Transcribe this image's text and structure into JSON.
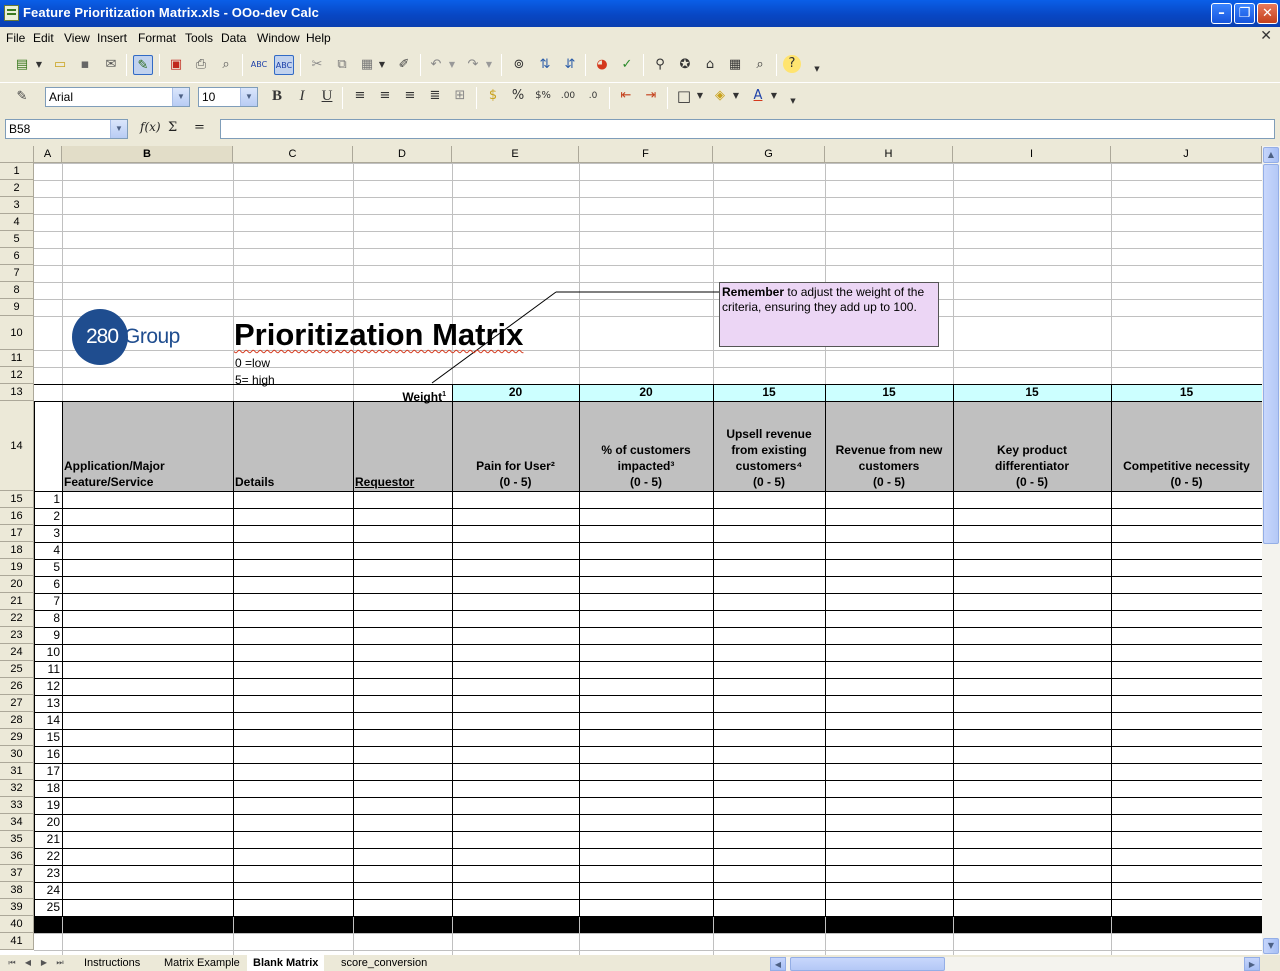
{
  "window": {
    "title": "Feature Prioritization Matrix.xls - OOo-dev Calc"
  },
  "menu": [
    "File",
    "Edit",
    "View",
    "Insert",
    "Format",
    "Tools",
    "Data",
    "Window",
    "Help"
  ],
  "font": {
    "name": "Arial",
    "size": "10"
  },
  "name_box": "B58",
  "formula_buttons": {
    "function": "f(x)",
    "sum": "Σ",
    "equals": "="
  },
  "columns": [
    "A",
    "B",
    "C",
    "D",
    "E",
    "F",
    "G",
    "H",
    "I",
    "J"
  ],
  "rows": [
    "1",
    "2",
    "3",
    "4",
    "5",
    "6",
    "7",
    "8",
    "9",
    "10",
    "11",
    "12",
    "13",
    "14",
    "15",
    "16",
    "17",
    "18",
    "19",
    "20",
    "21",
    "22",
    "23",
    "24",
    "25",
    "26",
    "27",
    "28",
    "29",
    "30",
    "31",
    "32",
    "33",
    "34",
    "35",
    "36",
    "37",
    "38",
    "39",
    "40",
    "41"
  ],
  "sheet": {
    "logo": {
      "number": "280",
      "word": "Group"
    },
    "title": "Prioritization Matrix",
    "scale_low": "0 =low",
    "scale_high": "5= high",
    "note": {
      "bold": "Remember",
      "text": " to adjust the weight of the criteria, ensuring they add up to 100."
    },
    "weight_label": "Weight",
    "weight_sup": "1",
    "weights": [
      "20",
      "20",
      "15",
      "15",
      "15",
      "15"
    ],
    "headers": {
      "app": [
        "Application/Major",
        "Feature/Service"
      ],
      "details": "Details",
      "requestor": "Requestor",
      "criteria": [
        {
          "lines": [
            "Pain for User²",
            "(0 - 5)"
          ]
        },
        {
          "lines": [
            "% of customers",
            "impacted³",
            "(0 - 5)"
          ]
        },
        {
          "lines": [
            "Upsell revenue",
            "from existing",
            "customers⁴",
            "(0 - 5)"
          ]
        },
        {
          "lines": [
            "Revenue from new",
            "customers",
            "(0 - 5)"
          ]
        },
        {
          "lines": [
            "Key product",
            "differentiator",
            "(0 - 5)"
          ]
        },
        {
          "lines": [
            "Competitive necessity",
            "(0 - 5)"
          ]
        }
      ]
    },
    "item_numbers": [
      "1",
      "2",
      "3",
      "4",
      "5",
      "6",
      "7",
      "8",
      "9",
      "10",
      "11",
      "12",
      "13",
      "14",
      "15",
      "16",
      "17",
      "18",
      "19",
      "20",
      "21",
      "22",
      "23",
      "24",
      "25"
    ]
  },
  "tabs": [
    "Instructions",
    "Matrix Example",
    "Blank Matrix",
    "score_conversion"
  ],
  "active_tab": "Blank Matrix",
  "colors": {
    "weight_row": "#ccffff",
    "header_row": "#c0c0c0",
    "note_bg": "#ecd6f5",
    "logo_blue": "#1f4d8f",
    "title_bar": "#0a5fe8"
  }
}
